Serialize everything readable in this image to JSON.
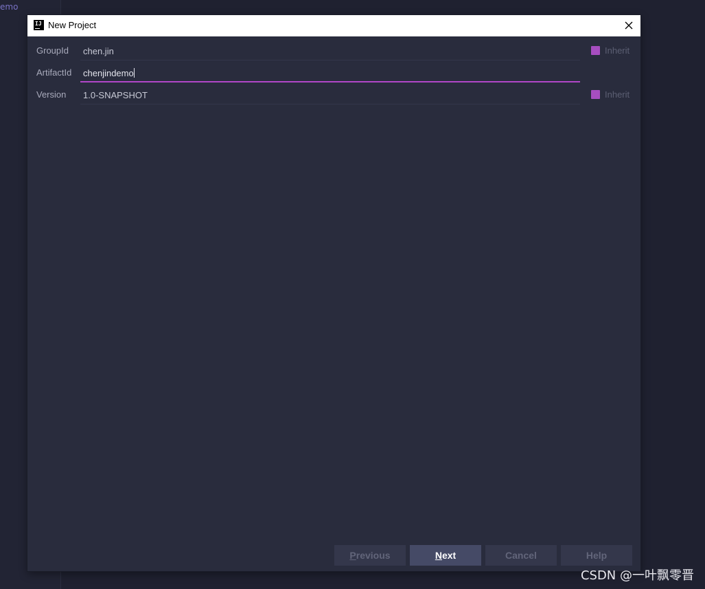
{
  "background": {
    "left_panel_text": "emo",
    "watermark": "CSDN @一叶飘零晋"
  },
  "dialog": {
    "title": "New Project",
    "app_icon_text": "IJ",
    "fields": [
      {
        "label": "GroupId",
        "value": "chen.jin",
        "inherit_label": "Inherit",
        "inherit_checked": true
      },
      {
        "label": "ArtifactId",
        "value": "chenjindemo",
        "focused": true
      },
      {
        "label": "Version",
        "value": "1.0-SNAPSHOT",
        "inherit_label": "Inherit",
        "inherit_checked": true
      }
    ],
    "buttons": {
      "previous": {
        "mnemonic": "P",
        "rest": "revious",
        "enabled": false
      },
      "next": {
        "mnemonic": "N",
        "rest": "ext",
        "enabled": true
      },
      "cancel": {
        "label": "Cancel"
      },
      "help": {
        "label": "Help"
      }
    }
  },
  "colors": {
    "accent": "#b147c9",
    "dialog_bg": "#292c3d",
    "primary_button": "#454a66"
  }
}
